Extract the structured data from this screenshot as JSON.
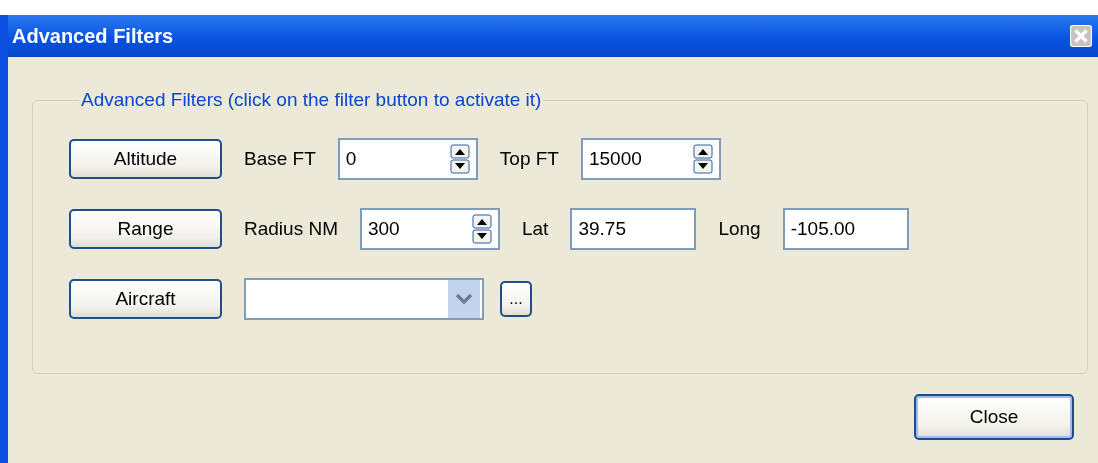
{
  "window": {
    "title": "Advanced Filters"
  },
  "group": {
    "legend": "Advanced Filters (click on the filter button to activate it)"
  },
  "rows": [
    {
      "button": "Altitude",
      "controls": [
        {
          "kind": "label",
          "text": "Base FT"
        },
        {
          "kind": "spinner",
          "value": "0"
        },
        {
          "kind": "label",
          "text": "Top FT"
        },
        {
          "kind": "spinner",
          "value": "15000"
        }
      ]
    },
    {
      "button": "Range",
      "controls": [
        {
          "kind": "label",
          "text": "Radius NM"
        },
        {
          "kind": "spinner",
          "value": "300"
        },
        {
          "kind": "label",
          "text": "Lat"
        },
        {
          "kind": "text",
          "value": "39.75"
        },
        {
          "kind": "label",
          "text": "Long"
        },
        {
          "kind": "text",
          "value": "-105.00"
        }
      ]
    },
    {
      "button": "Aircraft",
      "controls": [
        {
          "kind": "combo"
        },
        {
          "kind": "button",
          "text": "..."
        }
      ]
    }
  ],
  "footer": {
    "button": "Close"
  }
}
